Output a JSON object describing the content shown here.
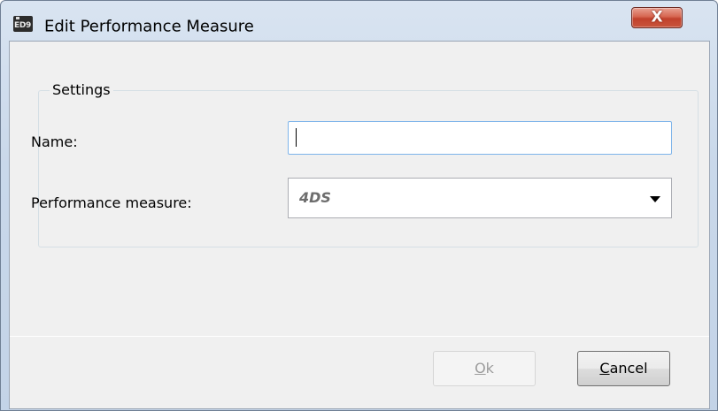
{
  "window": {
    "title": "Edit Performance Measure",
    "app_icon": {
      "name": "ed9-app-icon",
      "text": "ED9"
    },
    "close_icon": "close-icon",
    "close_glyph": "X"
  },
  "settings": {
    "group_title": "Settings",
    "name": {
      "label": "Name:",
      "value": "",
      "placeholder": ""
    },
    "performance_measure": {
      "label": "Performance measure:",
      "selected": "4DS"
    }
  },
  "buttons": {
    "ok": {
      "label": "Ok",
      "accel": "O",
      "rest": "k",
      "enabled": false
    },
    "cancel": {
      "label": "Cancel",
      "accel": "C",
      "rest": "ancel",
      "enabled": true
    }
  }
}
